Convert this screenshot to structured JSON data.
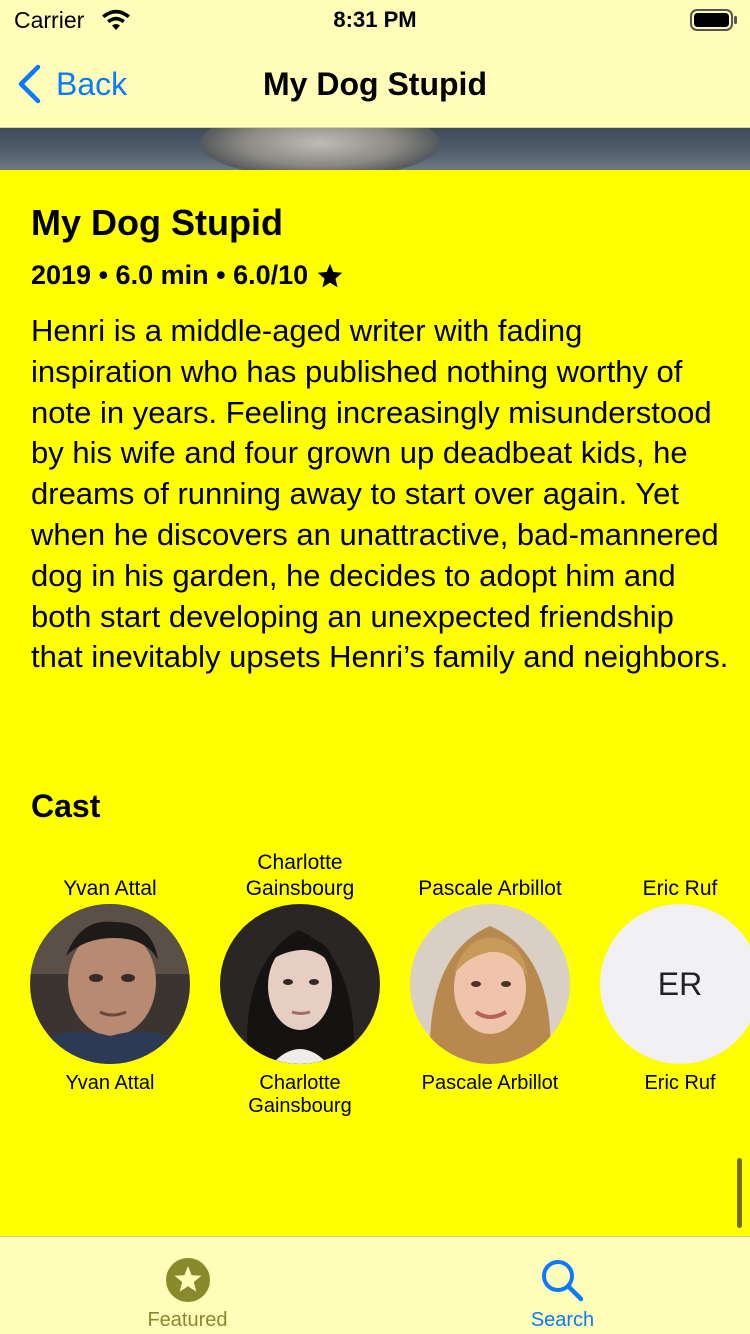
{
  "status": {
    "carrier": "Carrier",
    "time": "8:31 PM"
  },
  "nav": {
    "back_label": "Back",
    "title": "My Dog Stupid"
  },
  "movie": {
    "title": "My Dog Stupid",
    "year": "2019",
    "runtime": "6.0 min",
    "rating": "6.0/10",
    "separator": " • ",
    "overview": "Henri is a middle-aged writer with fading inspiration who has published nothing worthy of note in years. Feeling increasingly misunderstood by his wife and four grown up deadbeat kids, he dreams of running away to start over again. Yet when he discovers an unattractive, bad-mannered dog in his garden, he decides to adopt him and both start developing an unexpected friendship that inevitably upsets Henri’s family and neighbors."
  },
  "cast": {
    "heading": "Cast",
    "members": [
      {
        "name": "Yvan Attal",
        "character": "Yvan Attal"
      },
      {
        "name": "Charlotte Gainsbourg",
        "character": "Charlotte Gainsbourg"
      },
      {
        "name": "Pascale Arbillot",
        "character": "Pascale Arbillot"
      },
      {
        "name": "Eric Ruf",
        "character": "Eric Ruf",
        "initials": "ER"
      }
    ]
  },
  "tabs": [
    {
      "label": "Featured",
      "icon": "star-circle-icon",
      "selected": false,
      "color": "#8a8a2c"
    },
    {
      "label": "Search",
      "icon": "magnifier-icon",
      "selected": true,
      "color": "#0a7aff"
    }
  ],
  "colors": {
    "background": "#ffff00",
    "chrome": "#fffdb8",
    "accent": "#0a7aff"
  }
}
